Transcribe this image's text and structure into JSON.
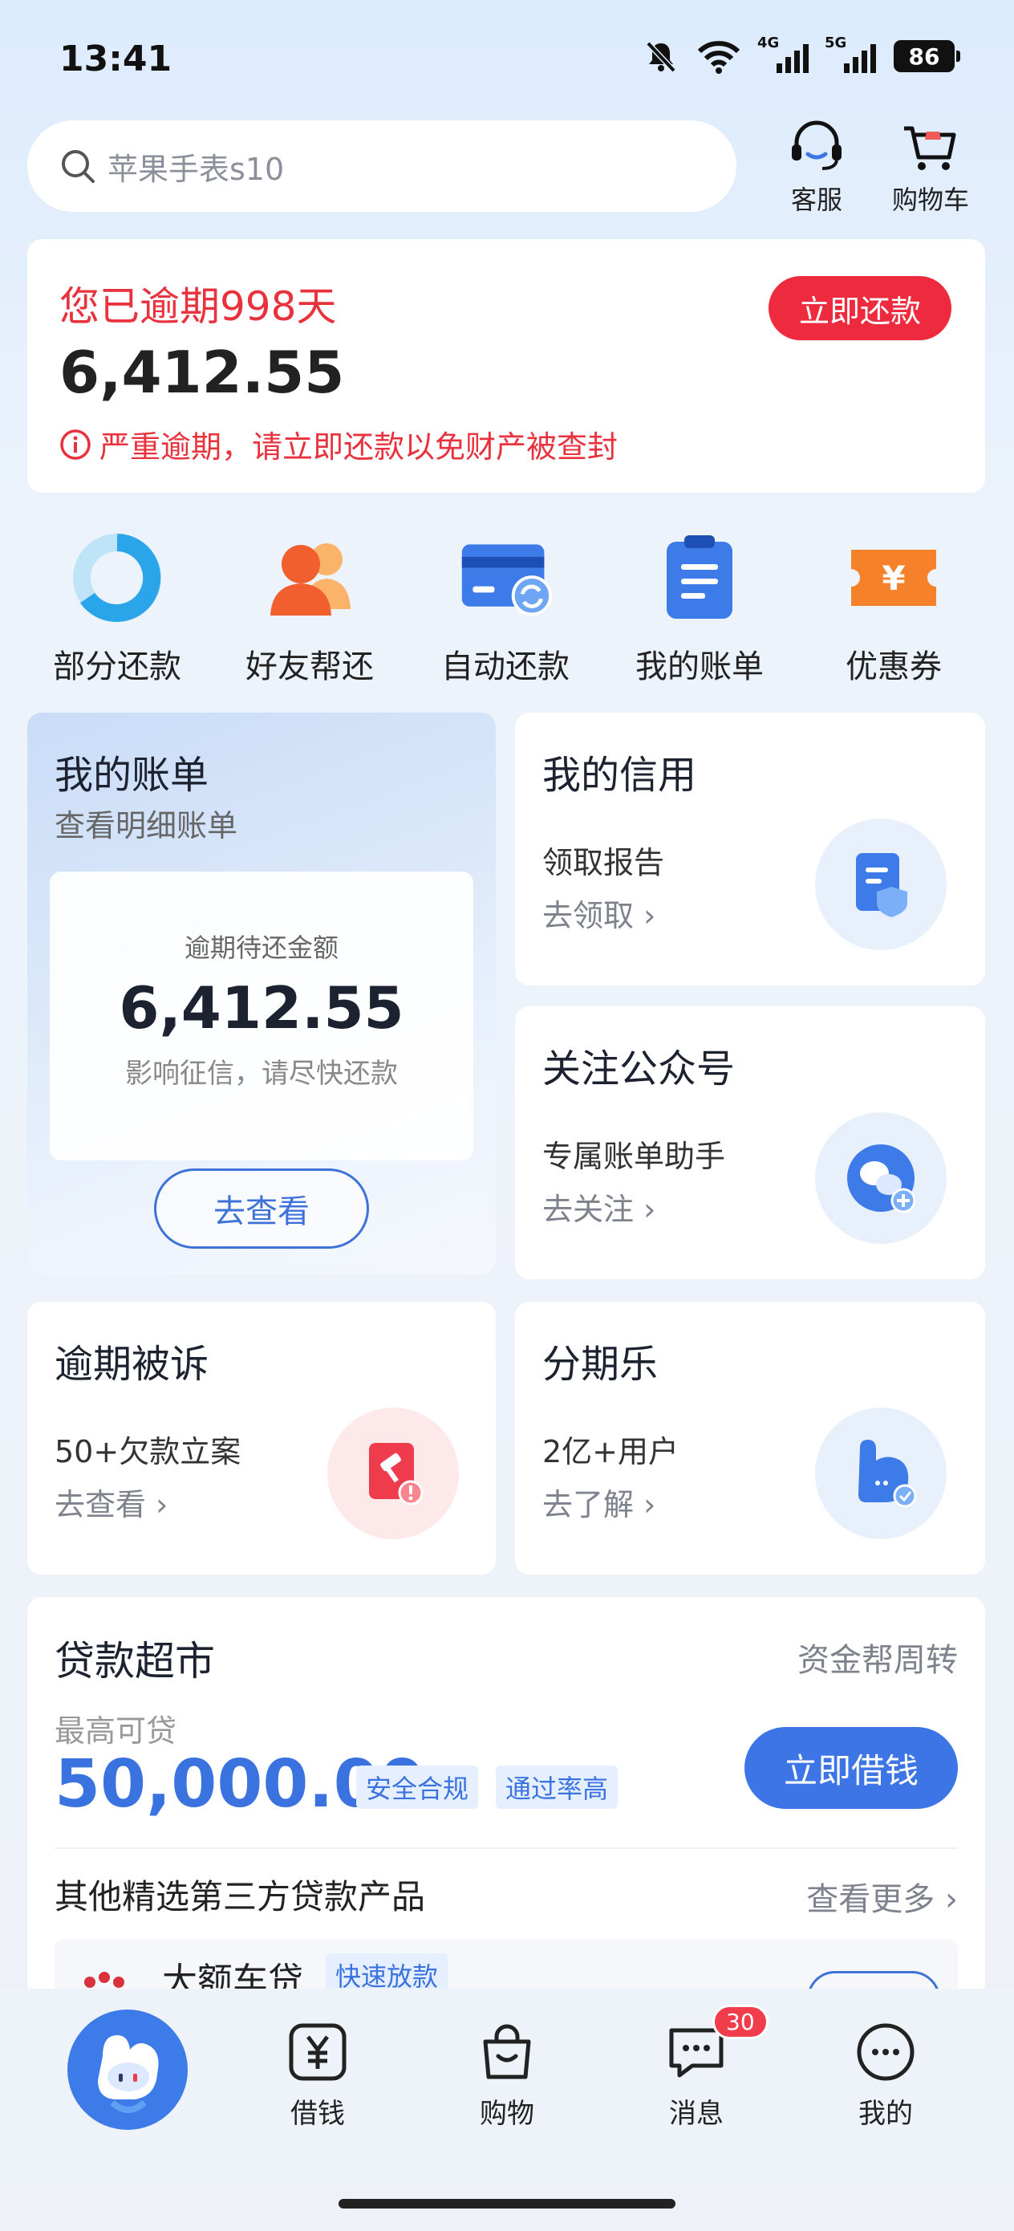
{
  "status_bar": {
    "time": "13:41",
    "net1": "4G",
    "net2": "5G",
    "battery": "86"
  },
  "search": {
    "placeholder": "苹果手表s10"
  },
  "header": {
    "service_label": "客服",
    "cart_label": "购物车"
  },
  "overdue": {
    "title": "您已逾期998天",
    "amount": "6,412.55",
    "warning": "严重逾期，请立即还款以免财产被查封",
    "button": "立即还款"
  },
  "quick_actions": [
    {
      "label": "部分还款",
      "icon": "pie-progress-icon"
    },
    {
      "label": "好友帮还",
      "icon": "friends-icon"
    },
    {
      "label": "自动还款",
      "icon": "auto-pay-card-icon"
    },
    {
      "label": "我的账单",
      "icon": "bill-icon"
    },
    {
      "label": "优惠券",
      "icon": "coupon-icon"
    }
  ],
  "bill_card": {
    "title": "我的账单",
    "subtitle": "查看明细账单",
    "inner_label": "逾期待还金额",
    "inner_amount": "6,412.55",
    "inner_note": "影响征信，请尽快还款",
    "button": "去查看"
  },
  "credit_card": {
    "title": "我的信用",
    "sub": "领取报告",
    "link": "去领取"
  },
  "official_card": {
    "title": "关注公众号",
    "sub": "专属账单助手",
    "link": "去关注"
  },
  "lawsuit_card": {
    "title": "逾期被诉",
    "sub": "50+欠款立案",
    "link": "去查看"
  },
  "installment_card": {
    "title": "分期乐",
    "sub": "2亿+用户",
    "link": "去了解"
  },
  "loan_market": {
    "title": "贷款超市",
    "right_text": "资金帮周转",
    "max_label": "最高可贷",
    "amount": "50,000.00",
    "tags": [
      "安全合规",
      "通过率高"
    ],
    "button": "立即借钱",
    "other_title": "其他精选第三方贷款产品",
    "more": "查看更多",
    "product_name": "大额车贷",
    "product_tag": "快速放款"
  },
  "bottom_nav": [
    {
      "label": "",
      "icon": "mascot-home-icon"
    },
    {
      "label": "借钱",
      "icon": "yuan-icon"
    },
    {
      "label": "购物",
      "icon": "shopping-bag-icon"
    },
    {
      "label": "消息",
      "icon": "message-icon",
      "badge": "30"
    },
    {
      "label": "我的",
      "icon": "profile-icon"
    }
  ],
  "colors": {
    "accent_blue": "#3d75e6",
    "danger_red": "#ee2a3e"
  }
}
